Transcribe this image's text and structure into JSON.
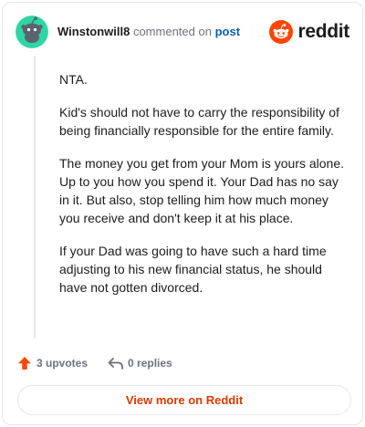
{
  "header": {
    "author": "Winstonwill8",
    "action_text": "commented on",
    "post_link": "post",
    "logo_text": "reddit",
    "avatar_icon": "snoo-avatar-icon",
    "logo_icon": "reddit-snoo-icon"
  },
  "comment": {
    "paragraphs": [
      "NTA.",
      "Kid's should not have to carry the responsibility of being financially responsible for the entire family.",
      "The money you get from your Mom is yours alone. Up to you how you spend it. Your Dad has no say in it. But also, stop telling him how much money you receive and don't keep it at his place.",
      "If your Dad was going to have such a hard time adjusting to his new financial status, he should have not gotten divorced."
    ]
  },
  "actions": {
    "upvotes": "3 upvotes",
    "replies": "0 replies",
    "upvote_icon": "upvote-arrow-icon",
    "reply_icon": "reply-arrow-icon"
  },
  "footer": {
    "view_more": "View more on Reddit"
  },
  "colors": {
    "brand": "#ff4500",
    "avatar_bg": "#2ed6a3",
    "link": "#0b5fb5",
    "view_more": "#d93a00",
    "muted": "#6b7280"
  }
}
